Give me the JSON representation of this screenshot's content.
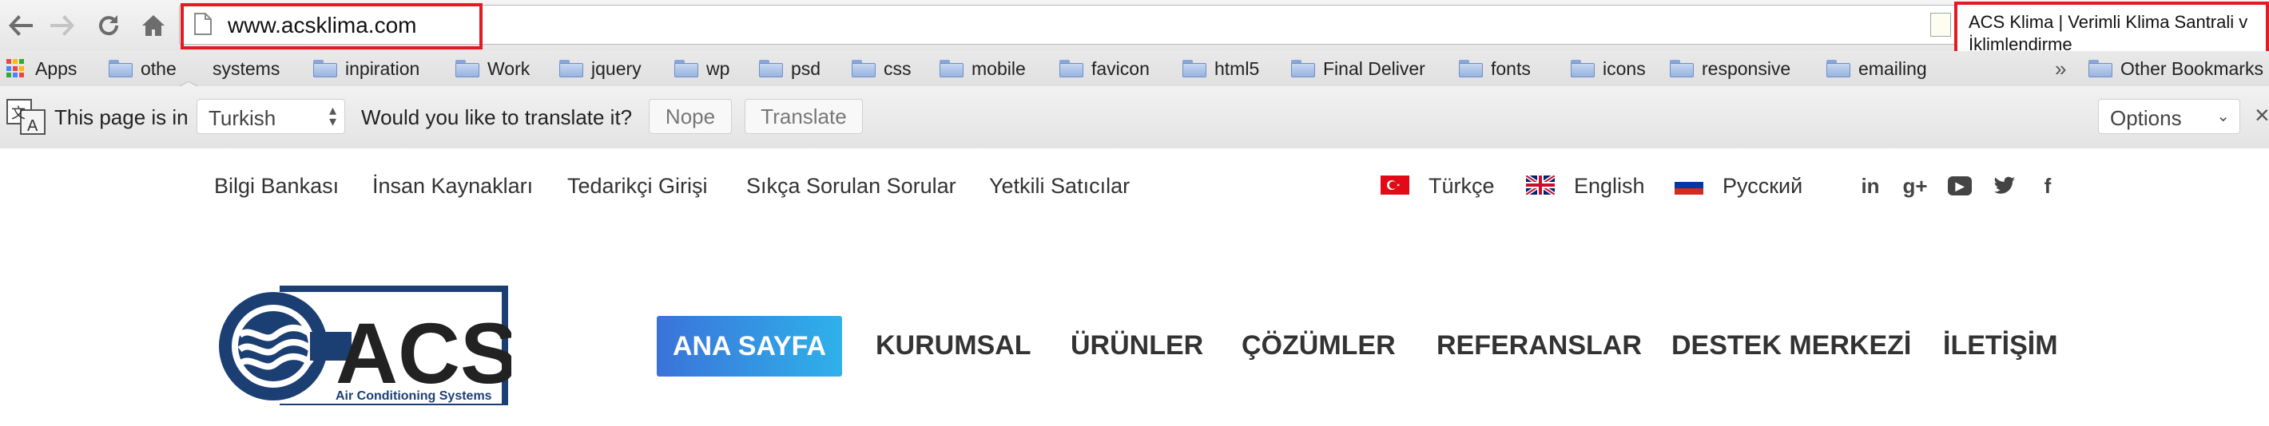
{
  "browser": {
    "url": "www.acsklima.com",
    "tab_tooltip_line1": "ACS Klima | Verimli Klima Santrali v",
    "tab_tooltip_line2": "İklimlendirme",
    "bookmarks": [
      "Apps",
      "othe",
      "systems",
      "inpiration",
      "Work",
      "jquery",
      "wp",
      "psd",
      "css",
      "mobile",
      "favicon",
      "html5",
      "Final Deliver",
      "fonts",
      "icons",
      "responsive",
      "emailing",
      "Other Bookmarks"
    ],
    "overflow_chevron": "»",
    "translate": {
      "prefix": "This page is in",
      "language": "Turkish",
      "question": "Would you like to translate it?",
      "nope": "Nope",
      "translate": "Translate",
      "options": "Options",
      "close": "×"
    },
    "highlight_color": "#e21b23"
  },
  "site": {
    "top_links": [
      "Bilgi Bankası",
      "İnsan Kaynakları",
      "Tedarikçi Girişi",
      "Sıkça Sorulan Sorular",
      "Yetkili Satıcılar"
    ],
    "languages": [
      "Türkçe",
      "English",
      "Русский"
    ],
    "social": [
      "linkedin-icon",
      "google-plus-icon",
      "youtube-icon",
      "twitter-icon",
      "facebook-icon"
    ],
    "social_glyphs": [
      "in",
      "g+",
      "▶",
      "t",
      "f"
    ],
    "logo": {
      "brand": "ACS",
      "tagline": "Air Conditioning Systems"
    },
    "menu": [
      "ANA SAYFA",
      "KURUMSAL",
      "ÜRÜNLER",
      "ÇÖZÜMLER",
      "REFERANSLAR",
      "DESTEK MERKEZİ",
      "İLETİŞİM"
    ],
    "accent_gradient": [
      "#3a73d9",
      "#2fb1ea"
    ]
  }
}
